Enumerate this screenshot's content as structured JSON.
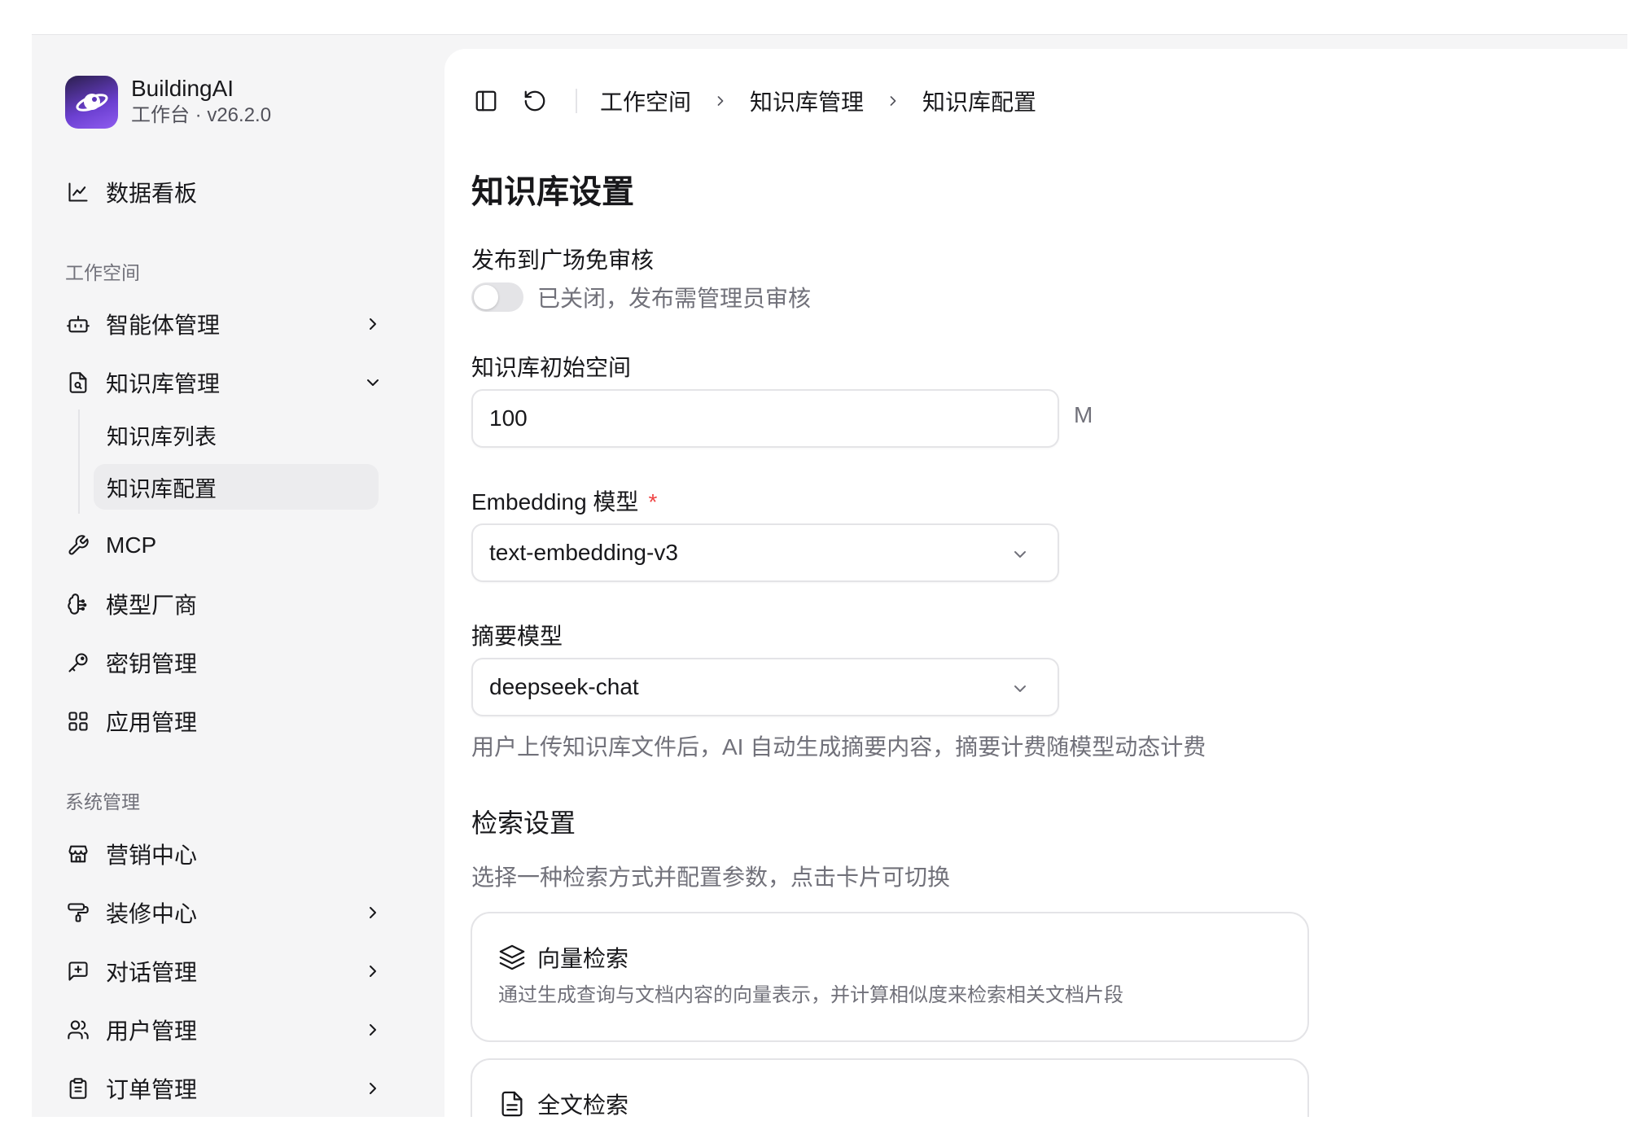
{
  "app": {
    "name": "BuildingAI",
    "subtitle": "工作台 · v26.2.0"
  },
  "sidebar": {
    "dashboard": "数据看板",
    "workspace_section": "工作空间",
    "items": [
      {
        "label": "智能体管理"
      },
      {
        "label": "知识库管理"
      },
      {
        "label": "MCP"
      },
      {
        "label": "模型厂商"
      },
      {
        "label": "密钥管理"
      },
      {
        "label": "应用管理"
      }
    ],
    "knowledge_sub": [
      {
        "label": "知识库列表"
      },
      {
        "label": "知识库配置"
      }
    ],
    "system_section": "系统管理",
    "system_items": [
      {
        "label": "营销中心"
      },
      {
        "label": "装修中心"
      },
      {
        "label": "对话管理"
      },
      {
        "label": "用户管理"
      },
      {
        "label": "订单管理"
      }
    ]
  },
  "breadcrumb": [
    "工作空间",
    "知识库管理",
    "知识库配置"
  ],
  "page": {
    "title": "知识库设置",
    "publish_label": "发布到广场免审核",
    "publish_status": "已关闭，发布需管理员审核",
    "publish_enabled": false,
    "space_label": "知识库初始空间",
    "space_value": "100",
    "space_unit": "M",
    "embedding_label": "Embedding 模型",
    "required_mark": "*",
    "embedding_value": "text-embedding-v3",
    "summary_label": "摘要模型",
    "summary_value": "deepseek-chat",
    "summary_hint": "用户上传知识库文件后，AI 自动生成摘要内容，摘要计费随模型动态计费",
    "search_title": "检索设置",
    "search_hint": "选择一种检索方式并配置参数，点击卡片可切换",
    "cards": [
      {
        "title": "向量检索",
        "desc": "通过生成查询与文档内容的向量表示，并计算相似度来检索相关文档片段"
      },
      {
        "title": "全文检索"
      }
    ]
  },
  "colors": {
    "accent": "#6b3fd0",
    "required": "#ef4444",
    "muted_text": "#71717a",
    "active_bg": "#ececee"
  }
}
